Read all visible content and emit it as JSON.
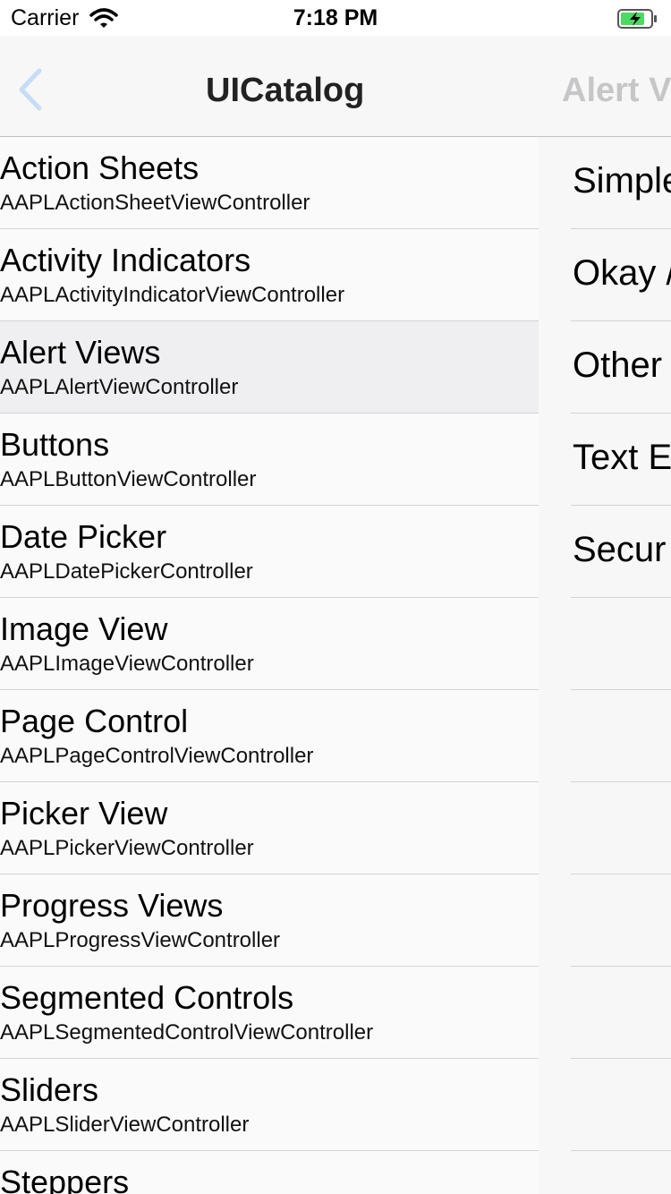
{
  "status": {
    "carrier": "Carrier",
    "time": "7:18 PM",
    "icons": [
      "wifi-icon",
      "battery-charging-icon"
    ]
  },
  "nav": {
    "title": "UICatalog",
    "next_title": "Alert V",
    "back_icon": "chevron-left-icon"
  },
  "list": {
    "items": [
      {
        "title": "Action Sheets",
        "subtitle": "AAPLActionSheetViewController"
      },
      {
        "title": "Activity Indicators",
        "subtitle": "AAPLActivityIndicatorViewController"
      },
      {
        "title": "Alert Views",
        "subtitle": "AAPLAlertViewController",
        "selected": true
      },
      {
        "title": "Buttons",
        "subtitle": "AAPLButtonViewController"
      },
      {
        "title": "Date Picker",
        "subtitle": "AAPLDatePickerController"
      },
      {
        "title": "Image View",
        "subtitle": "AAPLImageViewController"
      },
      {
        "title": "Page Control",
        "subtitle": "AAPLPageControlViewController"
      },
      {
        "title": "Picker View",
        "subtitle": "AAPLPickerViewController"
      },
      {
        "title": "Progress Views",
        "subtitle": "AAPLProgressViewController"
      },
      {
        "title": "Segmented Controls",
        "subtitle": "AAPLSegmentedControlViewController"
      },
      {
        "title": "Sliders",
        "subtitle": "AAPLSliderViewController"
      },
      {
        "title": "Steppers",
        "subtitle": ""
      }
    ]
  },
  "detail": {
    "items": [
      "Simple",
      "Okay /",
      "Other",
      "Text E",
      "Secur",
      "",
      "",
      "",
      "",
      "",
      "",
      ""
    ]
  },
  "colors": {
    "accent": "#007aff",
    "separator": "#d4d4d6",
    "selected_row": "#efeff1",
    "battery_fill": "#4cd964"
  }
}
